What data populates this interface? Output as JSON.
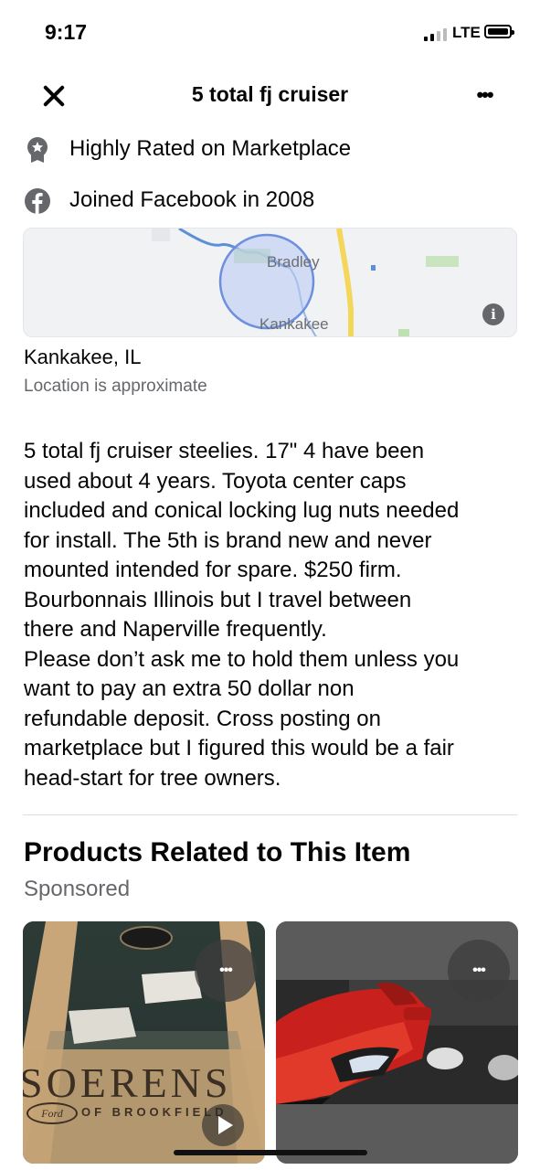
{
  "status_bar": {
    "time": "9:17",
    "network": "LTE"
  },
  "header": {
    "title": "5 total fj cruiser",
    "more_label": "•••"
  },
  "seller_info": [
    {
      "icon": "badge-icon",
      "text": "Highly Rated on Marketplace"
    },
    {
      "icon": "facebook-icon",
      "text": "Joined Facebook in 2008"
    }
  ],
  "map": {
    "labels": [
      "Bradley",
      "Kankakee"
    ],
    "info_label": "i"
  },
  "location": {
    "name": "Kankakee, IL",
    "note": "Location is approximate"
  },
  "description": "5 total fj cruiser steelies. 17\" 4 have been\nused about 4 years. Toyota center caps\nincluded and conical locking lug nuts needed\nfor install. The 5th is brand new and never\nmounted intended for spare. $250 firm.\nBourbonnais Illinois but I travel between\nthere and Naperville frequently.\nPlease don’t ask me to hold them unless you\nwant to pay an extra 50 dollar non\nrefundable deposit. Cross posting on\nmarketplace but I figured this would be a fair\nhead-start for tree owners.",
  "related": {
    "title": "Products Related to This Item",
    "sponsored": "Sponsored",
    "cards": [
      {
        "name": "cornhole-boards",
        "banner": "SOERENS",
        "sub": "OF BROOKFIELD",
        "logo": "Ford",
        "more_label": "•••"
      },
      {
        "name": "red-car",
        "more_label": "•••"
      }
    ]
  },
  "colors": {
    "accent": "#1877f2",
    "secondary_text": "#65676b",
    "map_circle": "#6d8fe0"
  }
}
